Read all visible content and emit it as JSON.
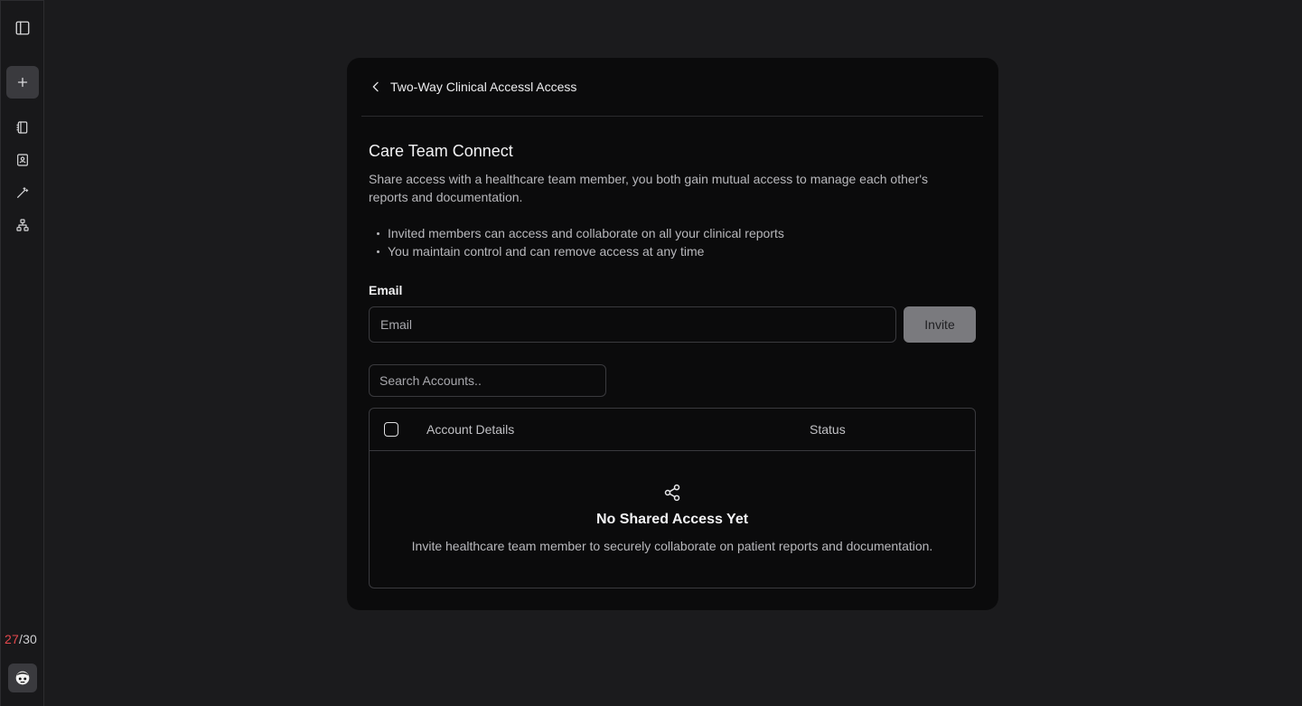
{
  "sidebar": {
    "icons": [
      "sidebar-toggle-icon",
      "plus-icon",
      "notebook-icon",
      "contact-book-icon",
      "magic-wand-icon",
      "network-icon"
    ],
    "usage_used": "27",
    "usage_total": "/30"
  },
  "card": {
    "header_title": "Two-Way Clinical Accessl Access",
    "title": "Care Team Connect",
    "description": "Share access with a healthcare team member, you both gain mutual access to manage each other's reports and documentation.",
    "bullets": [
      "Invited members can access and collaborate on all your clinical reports",
      "You maintain control and can remove access at any time"
    ],
    "email_label": "Email",
    "email_placeholder": "Email",
    "invite_label": "Invite",
    "search_placeholder": "Search Accounts..",
    "table": {
      "col_account": "Account Details",
      "col_status": "Status"
    },
    "empty_title": "No Shared Access Yet",
    "empty_description": "Invite healthcare team member to securely collaborate on patient reports and documentation."
  },
  "colors": {
    "background": "#1b1b1d",
    "card": "#0b0b0c",
    "usage_alert": "#e5484d",
    "invite_button": "#7a7a7e"
  }
}
